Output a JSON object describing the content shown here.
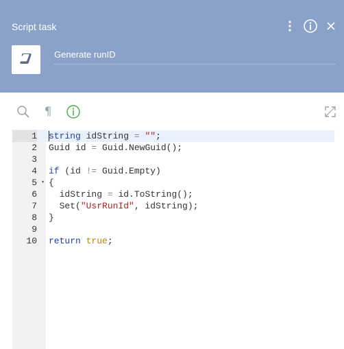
{
  "header": {
    "title": "Script task",
    "task_name": "Generate runID",
    "icons": [
      "more-vertical-icon",
      "info-icon",
      "close-icon",
      "script-scroll-icon"
    ],
    "background": "#8aa2c9"
  },
  "toolbar": {
    "icons": [
      "search-icon",
      "pilcrow-icon",
      "validate-info-icon",
      "expand-icon"
    ],
    "pilcrow_glyph": "¶",
    "validate_color": "#4caf50"
  },
  "editor": {
    "active_line": 1,
    "lines": [
      {
        "n": "1",
        "tokens": [
          [
            "kw",
            "string"
          ],
          [
            "txt",
            " idString "
          ],
          [
            "op",
            "="
          ],
          [
            "txt",
            " "
          ],
          [
            "str",
            "\"\""
          ],
          [
            "txt",
            ";"
          ]
        ]
      },
      {
        "n": "2",
        "tokens": [
          [
            "txt",
            "Guid id "
          ],
          [
            "op",
            "="
          ],
          [
            "txt",
            " Guid.NewGuid();"
          ]
        ]
      },
      {
        "n": "3",
        "tokens": []
      },
      {
        "n": "4",
        "tokens": [
          [
            "kw",
            "if"
          ],
          [
            "txt",
            " (id "
          ],
          [
            "op",
            "!="
          ],
          [
            "txt",
            " Guid.Empty)"
          ]
        ]
      },
      {
        "n": "5",
        "fold": "▾",
        "tokens": [
          [
            "txt",
            "{"
          ]
        ]
      },
      {
        "n": "6",
        "tokens": [
          [
            "txt",
            "  idString "
          ],
          [
            "op",
            "="
          ],
          [
            "txt",
            " id.ToString();"
          ]
        ]
      },
      {
        "n": "7",
        "tokens": [
          [
            "txt",
            "  Set("
          ],
          [
            "str",
            "\"UsrRunId\""
          ],
          [
            "txt",
            ", idString);"
          ]
        ]
      },
      {
        "n": "8",
        "tokens": [
          [
            "txt",
            "}"
          ]
        ]
      },
      {
        "n": "9",
        "tokens": []
      },
      {
        "n": "10",
        "tokens": [
          [
            "kw",
            "return"
          ],
          [
            "txt",
            " "
          ],
          [
            "lit",
            "true"
          ],
          [
            "txt",
            ";"
          ]
        ]
      }
    ]
  }
}
